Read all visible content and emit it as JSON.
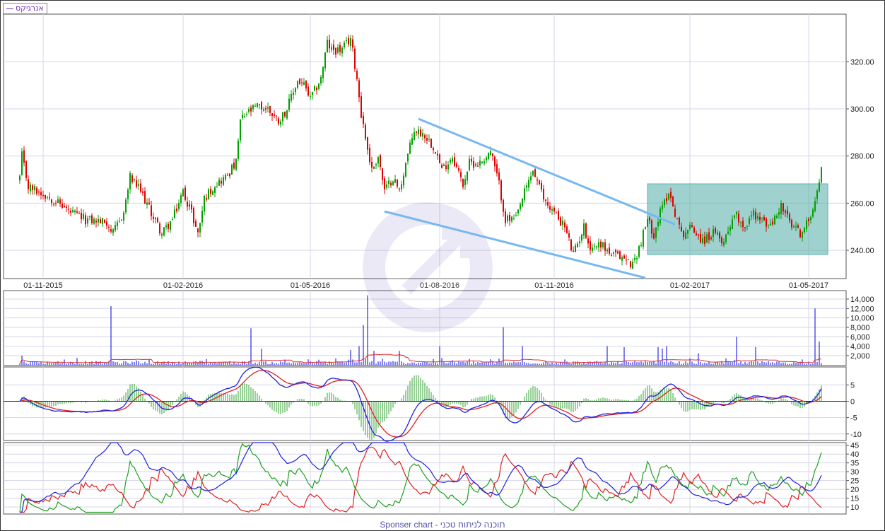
{
  "legend": {
    "label": "אנרגיקס"
  },
  "footer": {
    "text": "Sponser chart - תוכנה לניתוח טכני"
  },
  "colors": {
    "up": "#00a000",
    "down": "#e00000",
    "grid": "#d4d4e8",
    "trendline": "#78b8f0",
    "zone": "#5fb3ae",
    "volume": "#0000e0",
    "volume_ma": "#e03030",
    "macd": "#2020e0",
    "signal": "#e02020",
    "hist": "#30a030",
    "di_plus": "#20a020",
    "di_minus": "#e02020",
    "adx": "#2020e0"
  },
  "chart_data": [
    {
      "type": "candlestick",
      "title": "אנרגיקס",
      "x_unit": "trading day index",
      "date_ticks": [
        {
          "day": 11,
          "label": "01-11-2015"
        },
        {
          "day": 77,
          "label": "01-02-2016"
        },
        {
          "day": 137,
          "label": "01-05-2016"
        },
        {
          "day": 198,
          "label": "01-08-2016"
        },
        {
          "day": 252,
          "label": "01-11-2016"
        },
        {
          "day": 316,
          "label": "01-02-2017"
        },
        {
          "day": 372,
          "label": "01-05-2017"
        }
      ],
      "ylim": [
        228,
        340.2
      ],
      "y_ticks": [
        "240.00",
        "260.00",
        "280.00",
        "300.00",
        "320.00"
      ],
      "days": 379,
      "close_anchors": [
        [
          0,
          271
        ],
        [
          1,
          280
        ],
        [
          4,
          267
        ],
        [
          11,
          264
        ],
        [
          17,
          261
        ],
        [
          24,
          256
        ],
        [
          31,
          253
        ],
        [
          41,
          252
        ],
        [
          44,
          247
        ],
        [
          49,
          256
        ],
        [
          52,
          271
        ],
        [
          57,
          265
        ],
        [
          62,
          256
        ],
        [
          67,
          247
        ],
        [
          72,
          253
        ],
        [
          77,
          265
        ],
        [
          81,
          256
        ],
        [
          84,
          247
        ],
        [
          87,
          262
        ],
        [
          92,
          268
        ],
        [
          97,
          271
        ],
        [
          102,
          277
        ],
        [
          104,
          295
        ],
        [
          107,
          298
        ],
        [
          112,
          301
        ],
        [
          117,
          300
        ],
        [
          122,
          295
        ],
        [
          126,
          300
        ],
        [
          131,
          312
        ],
        [
          134,
          310
        ],
        [
          137,
          304
        ],
        [
          142,
          313
        ],
        [
          145,
          328
        ],
        [
          147,
          325
        ],
        [
          152,
          325
        ],
        [
          156,
          330
        ],
        [
          159,
          313
        ],
        [
          161,
          298
        ],
        [
          164,
          283
        ],
        [
          166,
          274
        ],
        [
          169,
          280
        ],
        [
          172,
          265
        ],
        [
          176,
          271
        ],
        [
          179,
          265
        ],
        [
          182,
          277
        ],
        [
          186,
          291
        ],
        [
          191,
          289
        ],
        [
          196,
          283
        ],
        [
          199,
          274
        ],
        [
          204,
          280
        ],
        [
          209,
          268
        ],
        [
          212,
          277
        ],
        [
          217,
          277
        ],
        [
          222,
          282
        ],
        [
          226,
          268
        ],
        [
          229,
          253
        ],
        [
          234,
          253
        ],
        [
          237,
          262
        ],
        [
          242,
          274
        ],
        [
          247,
          262
        ],
        [
          252,
          256
        ],
        [
          257,
          250
        ],
        [
          261,
          238
        ],
        [
          266,
          250
        ],
        [
          269,
          241
        ],
        [
          274,
          243
        ],
        [
          279,
          238
        ],
        [
          284,
          237
        ],
        [
          289,
          234
        ],
        [
          292,
          241
        ],
        [
          296,
          253
        ],
        [
          299,
          247
        ],
        [
          302,
          256
        ],
        [
          306,
          265
        ],
        [
          309,
          256
        ],
        [
          312,
          247
        ],
        [
          317,
          250
        ],
        [
          322,
          244
        ],
        [
          327,
          247
        ],
        [
          332,
          244
        ],
        [
          337,
          256
        ],
        [
          342,
          250
        ],
        [
          346,
          256
        ],
        [
          349,
          253
        ],
        [
          354,
          250
        ],
        [
          359,
          259
        ],
        [
          364,
          250
        ],
        [
          369,
          247
        ],
        [
          372,
          253
        ],
        [
          376,
          265
        ],
        [
          378,
          274
        ]
      ],
      "annotations": {
        "trendlines": [
          {
            "from": [
              188,
              295.8
            ],
            "to": [
              309,
              251
            ]
          },
          {
            "from": [
              172,
              256.5
            ],
            "to": [
              295,
              228.3
            ]
          }
        ],
        "zone": {
          "day_from": 296,
          "day_to": 381,
          "price_from": 238.2,
          "price_to": 268.2
        }
      }
    },
    {
      "type": "bar",
      "title": "Volume",
      "ylim": [
        0,
        15000
      ],
      "y_ticks": [
        "2,000",
        "4,000",
        "6,000",
        "8,000",
        "10,000",
        "12,000",
        "14,000"
      ],
      "y_tick_values": [
        2000,
        4000,
        6000,
        8000,
        10000,
        12000,
        14000
      ],
      "baseline_range": [
        200,
        1500
      ],
      "spikes": [
        [
          1,
          2000
        ],
        [
          27,
          1500
        ],
        [
          43,
          12500
        ],
        [
          109,
          7800
        ],
        [
          114,
          3500
        ],
        [
          156,
          3200
        ],
        [
          160,
          4000
        ],
        [
          162,
          8500
        ],
        [
          164,
          14800
        ],
        [
          167,
          3000
        ],
        [
          179,
          3000
        ],
        [
          198,
          4000
        ],
        [
          228,
          8000
        ],
        [
          237,
          4000
        ],
        [
          277,
          4000
        ],
        [
          285,
          3800
        ],
        [
          301,
          3800
        ],
        [
          303,
          3500
        ],
        [
          305,
          4000
        ],
        [
          320,
          2500
        ],
        [
          338,
          6000
        ],
        [
          347,
          3800
        ],
        [
          375,
          12000
        ],
        [
          377,
          5000
        ]
      ]
    },
    {
      "type": "line",
      "title": "MACD",
      "ylim": [
        -12,
        10.5
      ],
      "y_ticks": [
        "5",
        "0",
        "-5",
        "-10"
      ],
      "y_tick_values": [
        5,
        0,
        -5,
        -10
      ],
      "params": [
        12,
        26,
        9
      ]
    },
    {
      "type": "line",
      "title": "DMI / ADX",
      "ylim": [
        6,
        46.5
      ],
      "y_ticks": [
        "45",
        "40",
        "35",
        "30",
        "25",
        "20",
        "15",
        "10"
      ],
      "y_tick_values": [
        45,
        40,
        35,
        30,
        25,
        20,
        15,
        10
      ],
      "period": 14
    }
  ]
}
